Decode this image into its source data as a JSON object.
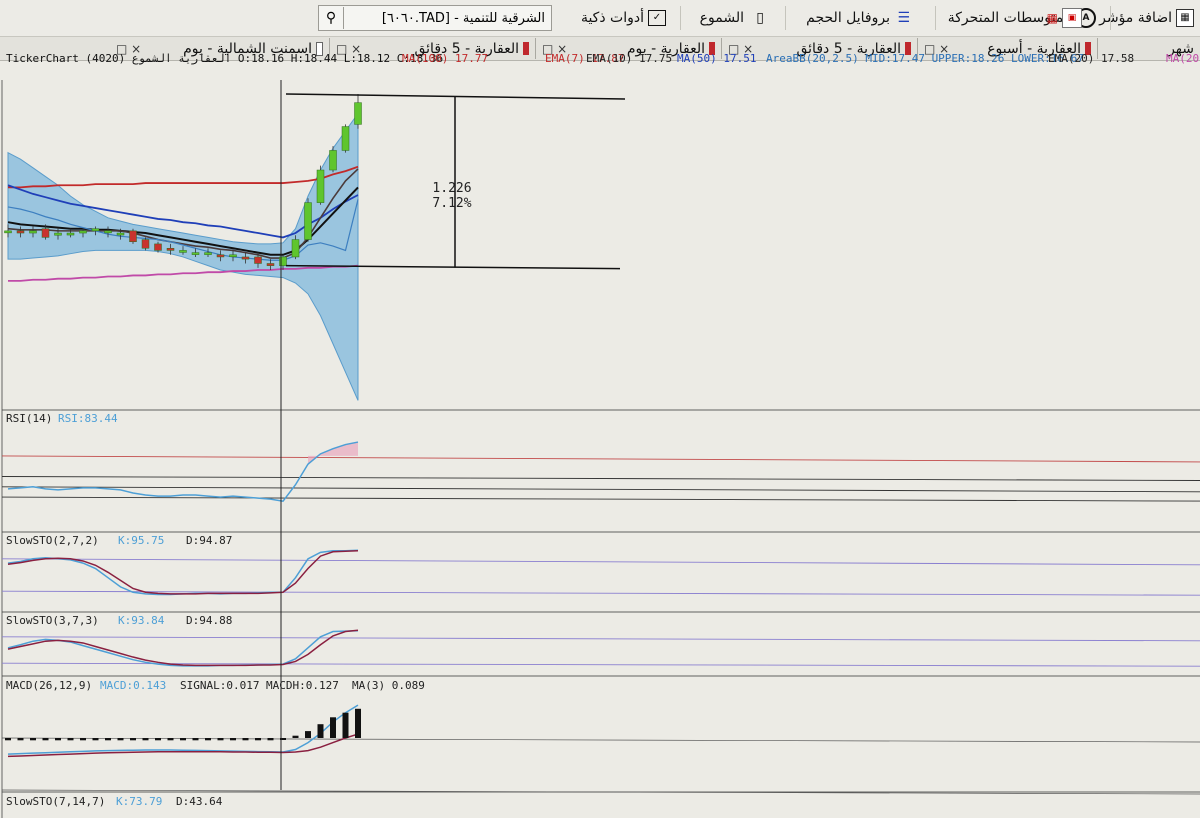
{
  "toolbar": {
    "add_indicator": "اضافة مؤشر",
    "moving_averages": "المتوسطات المتحركة",
    "volume_profile": "بروفايل الحجم",
    "candles": "الشموع",
    "smart_tools": "أدوات ذكية",
    "search_value": "الشرقية للتنمية - [TAD.٦٠٦٠]"
  },
  "tabs": [
    {
      "label": "شهر"
    },
    {
      "label": "العقارية - أسبوع"
    },
    {
      "label": "العقارية - 5 دقائق"
    },
    {
      "label": "العقارية - يوم"
    },
    {
      "label": "العقارية - 5 دقائق"
    },
    {
      "label": "اسمنت الشمالية - يوم"
    }
  ],
  "tab_controls": "□ ×",
  "header": {
    "source": "TickerChart",
    "symbol": "العقارية الشموع (4020)",
    "ohlc": "O:18.16  H:18.44  L:18.12  C:18.36",
    "indicators": [
      {
        "text": "MA(100)  17.77",
        "color": "#c22a2a"
      },
      {
        "text": "EMA(7)  17.87",
        "color": "#c22a2a"
      },
      {
        "text": "EMA(10)  17.75",
        "color": "#222222"
      },
      {
        "text": "MA(50)  17.51",
        "color": "#1f3fb8"
      },
      {
        "text": "AreaBB(20,2.5)  MID:17.47  UPPER:18.26  LOWER:16.67",
        "color": "#2a6fb5"
      },
      {
        "text": "EMA(20)  17.58",
        "color": "#222222"
      },
      {
        "text": "MA(20",
        "color": "#c04aa8"
      }
    ]
  },
  "measure": {
    "value": "1.226",
    "percent": "7.12%"
  },
  "panels": {
    "rsi": {
      "label": "RSI(14)",
      "value": "RSI:83.44"
    },
    "sto1": {
      "label": "SlowSTO(2,7,2)",
      "k": "K:95.75",
      "d": "D:94.87"
    },
    "sto2": {
      "label": "SlowSTO(3,7,3)",
      "k": "K:93.84",
      "d": "D:94.88"
    },
    "macd": {
      "label": "MACD(26,12,9)",
      "macd": "MACD:0.143",
      "signal": "SIGNAL:0.017",
      "hist": "MACDH:0.127",
      "ma": "MA(3)  0.089"
    },
    "sto3": {
      "label": "SlowSTO(7,14,7)",
      "k": "K:73.79",
      "d": "D:43.64"
    }
  },
  "colors": {
    "up": "#5fc52e",
    "down": "#c9332e",
    "band": "#7fb8dc",
    "ma100": "#c22a2a",
    "ma50": "#1f3fb8",
    "purple": "#c04aa8",
    "signal": "#8a2040",
    "k_line": "#4d9fd6"
  },
  "chart_data": {
    "type": "candlestick",
    "title": "",
    "candles": [
      {
        "o": 17.18,
        "h": 17.24,
        "l": 17.12,
        "c": 17.18
      },
      {
        "o": 17.18,
        "h": 17.22,
        "l": 17.12,
        "c": 17.16
      },
      {
        "o": 17.16,
        "h": 17.22,
        "l": 17.12,
        "c": 17.18
      },
      {
        "o": 17.2,
        "h": 17.24,
        "l": 17.1,
        "c": 17.12
      },
      {
        "o": 17.14,
        "h": 17.2,
        "l": 17.1,
        "c": 17.16
      },
      {
        "o": 17.16,
        "h": 17.2,
        "l": 17.12,
        "c": 17.16
      },
      {
        "o": 17.16,
        "h": 17.2,
        "l": 17.12,
        "c": 17.18
      },
      {
        "o": 17.18,
        "h": 17.22,
        "l": 17.14,
        "c": 17.2
      },
      {
        "o": 17.18,
        "h": 17.22,
        "l": 17.12,
        "c": 17.18
      },
      {
        "o": 17.16,
        "h": 17.2,
        "l": 17.1,
        "c": 17.16
      },
      {
        "o": 17.18,
        "h": 17.2,
        "l": 17.06,
        "c": 17.08
      },
      {
        "o": 17.1,
        "h": 17.12,
        "l": 17.0,
        "c": 17.02
      },
      {
        "o": 17.06,
        "h": 17.08,
        "l": 16.98,
        "c": 17.0
      },
      {
        "o": 17.02,
        "h": 17.06,
        "l": 16.96,
        "c": 17.0
      },
      {
        "o": 17.0,
        "h": 17.04,
        "l": 16.96,
        "c": 17.0
      },
      {
        "o": 16.98,
        "h": 17.02,
        "l": 16.94,
        "c": 16.98
      },
      {
        "o": 16.98,
        "h": 17.02,
        "l": 16.94,
        "c": 16.98
      },
      {
        "o": 16.96,
        "h": 17.0,
        "l": 16.9,
        "c": 16.94
      },
      {
        "o": 16.96,
        "h": 17.0,
        "l": 16.9,
        "c": 16.96
      },
      {
        "o": 16.94,
        "h": 16.98,
        "l": 16.88,
        "c": 16.92
      },
      {
        "o": 16.94,
        "h": 16.98,
        "l": 16.84,
        "c": 16.88
      },
      {
        "o": 16.88,
        "h": 16.92,
        "l": 16.82,
        "c": 16.86
      },
      {
        "o": 16.86,
        "h": 16.96,
        "l": 16.82,
        "c": 16.94
      },
      {
        "o": 16.94,
        "h": 17.14,
        "l": 16.92,
        "c": 17.1
      },
      {
        "o": 17.1,
        "h": 17.48,
        "l": 17.08,
        "c": 17.44
      },
      {
        "o": 17.44,
        "h": 17.78,
        "l": 17.42,
        "c": 17.74
      },
      {
        "o": 17.74,
        "h": 17.96,
        "l": 17.72,
        "c": 17.92
      },
      {
        "o": 17.92,
        "h": 18.16,
        "l": 17.9,
        "c": 18.14
      },
      {
        "o": 18.16,
        "h": 18.44,
        "l": 18.12,
        "c": 18.36
      }
    ],
    "overlays": {
      "ma100": [
        17.58,
        17.58,
        17.59,
        17.59,
        17.6,
        17.6,
        17.6,
        17.61,
        17.61,
        17.61,
        17.61,
        17.62,
        17.62,
        17.62,
        17.62,
        17.62,
        17.62,
        17.62,
        17.62,
        17.62,
        17.62,
        17.62,
        17.62,
        17.63,
        17.64,
        17.66,
        17.7,
        17.73,
        17.77
      ],
      "ma50": [
        17.6,
        17.56,
        17.52,
        17.49,
        17.46,
        17.43,
        17.41,
        17.39,
        17.37,
        17.35,
        17.33,
        17.31,
        17.29,
        17.28,
        17.26,
        17.25,
        17.23,
        17.22,
        17.2,
        17.18,
        17.16,
        17.14,
        17.12,
        17.16,
        17.24,
        17.3,
        17.38,
        17.45,
        17.51
      ],
      "ema_black": [
        17.26,
        17.24,
        17.23,
        17.22,
        17.21,
        17.2,
        17.2,
        17.19,
        17.19,
        17.18,
        17.17,
        17.16,
        17.14,
        17.12,
        17.1,
        17.08,
        17.06,
        17.04,
        17.02,
        17.0,
        16.98,
        16.96,
        16.96,
        17.0,
        17.1,
        17.22,
        17.34,
        17.46,
        17.58
      ],
      "ema_dark": [
        17.2,
        17.19,
        17.19,
        17.19,
        17.18,
        17.18,
        17.18,
        17.18,
        17.18,
        17.18,
        17.16,
        17.13,
        17.1,
        17.08,
        17.06,
        17.04,
        17.03,
        17.01,
        17.0,
        16.98,
        16.96,
        16.93,
        16.93,
        16.98,
        17.12,
        17.3,
        17.48,
        17.64,
        17.75
      ],
      "bb_upper": [
        17.9,
        17.84,
        17.76,
        17.68,
        17.6,
        17.5,
        17.42,
        17.36,
        17.3,
        17.27,
        17.24,
        17.22,
        17.2,
        17.18,
        17.16,
        17.14,
        17.12,
        17.1,
        17.08,
        17.07,
        17.06,
        17.06,
        17.07,
        17.2,
        17.5,
        17.74,
        17.94,
        18.1,
        18.26
      ],
      "bb_lower": [
        16.92,
        16.92,
        16.93,
        16.94,
        16.95,
        16.97,
        16.99,
        17.0,
        17.0,
        17.0,
        17.0,
        17.0,
        16.99,
        16.97,
        16.94,
        16.9,
        16.86,
        16.82,
        16.8,
        16.78,
        16.77,
        16.76,
        16.75,
        16.7,
        16.6,
        16.4,
        16.14,
        15.88,
        15.62
      ],
      "bb_mid": [
        17.4,
        17.38,
        17.35,
        17.31,
        17.28,
        17.24,
        17.21,
        17.18,
        17.15,
        17.13,
        17.12,
        17.11,
        17.1,
        17.08,
        17.05,
        17.02,
        16.99,
        16.96,
        16.94,
        16.93,
        16.92,
        16.91,
        16.91,
        16.95,
        17.05,
        17.07,
        17.04,
        17.0,
        17.47
      ],
      "ma20_purple": [
        16.72,
        16.72,
        16.73,
        16.73,
        16.74,
        16.74,
        16.75,
        16.75,
        16.76,
        16.76,
        16.77,
        16.77,
        16.78,
        16.78,
        16.79,
        16.79,
        16.8,
        16.8,
        16.81,
        16.81,
        16.82,
        16.82,
        16.83,
        16.83,
        16.84,
        16.84,
        16.85,
        16.85,
        16.86
      ]
    },
    "rsi": [
      38,
      39,
      40,
      38,
      37,
      38,
      39,
      39,
      38,
      37,
      34,
      32,
      31,
      31,
      32,
      32,
      31,
      30,
      31,
      30,
      29,
      28,
      26,
      42,
      62,
      72,
      77,
      81,
      83.44
    ],
    "sto1_k": [
      72,
      75,
      80,
      82,
      80,
      78,
      72,
      62,
      45,
      28,
      18,
      15,
      14,
      14,
      15,
      16,
      16,
      15,
      16,
      16,
      17,
      18,
      18,
      45,
      80,
      92,
      95,
      95,
      95.75
    ],
    "sto1_d": [
      70,
      73,
      77,
      80,
      81,
      80,
      76,
      68,
      55,
      40,
      25,
      18,
      16,
      15,
      15,
      15,
      16,
      16,
      16,
      16,
      16,
      17,
      18,
      35,
      62,
      85,
      93,
      94,
      94.87
    ],
    "sto2_k": [
      55,
      62,
      70,
      74,
      72,
      68,
      60,
      52,
      44,
      36,
      28,
      22,
      18,
      15,
      14,
      14,
      14,
      15,
      15,
      16,
      16,
      17,
      18,
      30,
      55,
      80,
      92,
      93,
      93.84
    ],
    "sto2_d": [
      52,
      58,
      64,
      70,
      72,
      70,
      66,
      58,
      50,
      42,
      34,
      27,
      22,
      18,
      16,
      15,
      15,
      15,
      15,
      15,
      16,
      16,
      17,
      24,
      40,
      62,
      82,
      92,
      94.88
    ],
    "macd_hist": [
      -0.01,
      -0.01,
      -0.01,
      -0.01,
      -0.01,
      -0.01,
      -0.01,
      -0.01,
      -0.01,
      -0.01,
      -0.01,
      -0.01,
      -0.01,
      -0.01,
      -0.01,
      -0.01,
      -0.01,
      -0.01,
      -0.01,
      -0.01,
      -0.01,
      -0.01,
      0.0,
      0.01,
      0.03,
      0.06,
      0.09,
      0.11,
      0.127
    ],
    "macd_line": [
      -0.07,
      -0.068,
      -0.066,
      -0.064,
      -0.062,
      -0.06,
      -0.058,
      -0.056,
      -0.055,
      -0.054,
      -0.053,
      -0.052,
      -0.052,
      -0.052,
      -0.053,
      -0.054,
      -0.055,
      -0.056,
      -0.057,
      -0.058,
      -0.059,
      -0.06,
      -0.061,
      -0.05,
      -0.02,
      0.02,
      0.07,
      0.11,
      0.143
    ],
    "macd_signal": [
      -0.08,
      -0.078,
      -0.076,
      -0.074,
      -0.072,
      -0.07,
      -0.068,
      -0.066,
      -0.064,
      -0.063,
      -0.062,
      -0.061,
      -0.06,
      -0.06,
      -0.06,
      -0.06,
      -0.06,
      -0.06,
      -0.061,
      -0.061,
      -0.062,
      -0.062,
      -0.063,
      -0.061,
      -0.055,
      -0.04,
      -0.02,
      0.0,
      0.017
    ]
  }
}
